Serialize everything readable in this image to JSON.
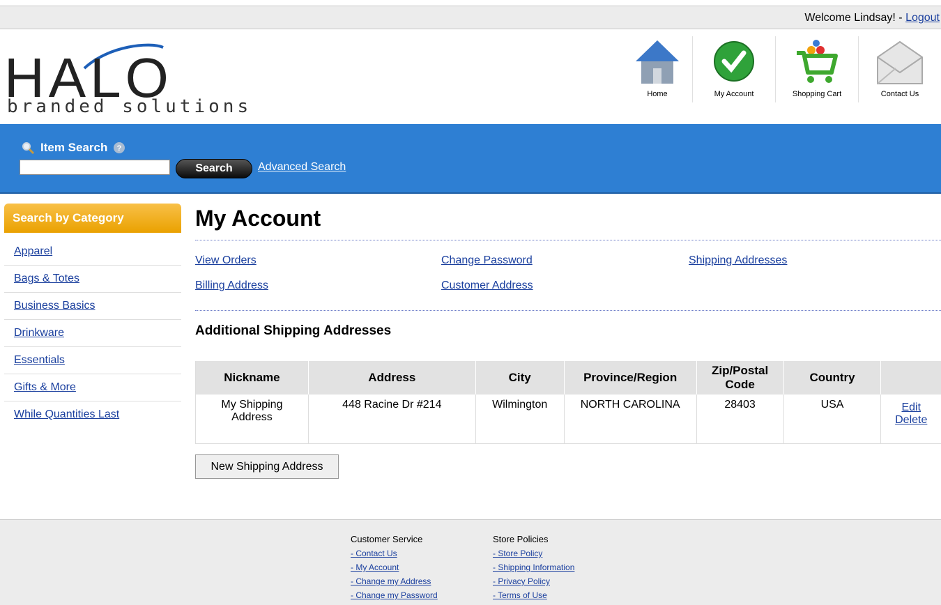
{
  "header": {
    "welcome_text": "Welcome Lindsay! - ",
    "logout_label": "Logout",
    "logo_main": "HALO",
    "logo_tagline": "branded solutions"
  },
  "nav_icons": [
    {
      "label": "Home",
      "icon": "home-icon"
    },
    {
      "label": "My Account",
      "icon": "checkmark-icon"
    },
    {
      "label": "Shopping Cart",
      "icon": "shopping-cart-icon"
    },
    {
      "label": "Contact Us",
      "icon": "envelope-icon"
    }
  ],
  "search": {
    "label": "Item Search",
    "button_label": "Search",
    "advanced_label": "Advanced Search",
    "value": ""
  },
  "sidebar": {
    "heading": "Search by Category",
    "items": [
      {
        "label": "Apparel"
      },
      {
        "label": "Bags & Totes"
      },
      {
        "label": "Business Basics"
      },
      {
        "label": "Drinkware"
      },
      {
        "label": "Essentials"
      },
      {
        "label": "Gifts & More"
      },
      {
        "label": "While Quantities Last"
      }
    ]
  },
  "main": {
    "title": "My Account",
    "links": {
      "view_orders": "View Orders",
      "change_password": "Change Password",
      "shipping_addresses": "Shipping Addresses",
      "billing_address": "Billing Address",
      "customer_address": "Customer Address"
    },
    "subtitle": "Additional Shipping Addresses",
    "table": {
      "headers": [
        "Nickname",
        "Address",
        "City",
        "Province/Region",
        "Zip/Postal Code",
        "Country",
        ""
      ],
      "rows": [
        {
          "nickname": "My Shipping Address",
          "address": "448 Racine Dr #214",
          "city": "Wilmington",
          "province": "NORTH CAROLINA",
          "zip": "28403",
          "country": "USA",
          "edit": "Edit",
          "delete": "Delete"
        }
      ]
    },
    "new_button": "New Shipping Address"
  },
  "footer": {
    "customer_service": {
      "heading": "Customer Service",
      "links": [
        "- Contact Us",
        "- My Account",
        "- Change my Address",
        "- Change my Password"
      ]
    },
    "store_policies": {
      "heading": "Store Policies",
      "links": [
        "- Store Policy",
        "- Shipping Information",
        "- Privacy Policy",
        "- Terms of Use"
      ]
    }
  }
}
